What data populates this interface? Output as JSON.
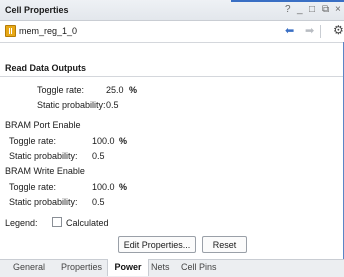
{
  "window": {
    "title": "Cell Properties",
    "controls": {
      "help": "?",
      "minimize": "_",
      "maximize": "□",
      "restore": "⧉",
      "close": "×"
    }
  },
  "toolbar": {
    "cell_name": "mem_reg_1_0",
    "back_glyph": "⬅",
    "forward_glyph": "➡",
    "settings_glyph": "⚙"
  },
  "read_outputs": {
    "header": "Read Data Outputs",
    "toggle_label": "Toggle rate:",
    "toggle_value": "25.0",
    "toggle_unit": "%",
    "static_label": "Static probability:",
    "static_value": "0.5"
  },
  "port_enable": {
    "title": "BRAM Port Enable",
    "toggle_label": "Toggle rate:",
    "toggle_value": "100.0",
    "toggle_unit": "%",
    "static_label": "Static probability:",
    "static_value": "0.5"
  },
  "write_enable": {
    "title": "BRAM Write Enable",
    "toggle_label": "Toggle rate:",
    "toggle_value": "100.0",
    "toggle_unit": "%",
    "static_label": "Static probability:",
    "static_value": "0.5"
  },
  "legend": {
    "label": "Legend:",
    "calculated": "Calculated"
  },
  "buttons": {
    "edit": "Edit Properties...",
    "reset": "Reset"
  },
  "tabs": [
    {
      "label": "General",
      "active": false
    },
    {
      "label": "Properties",
      "active": false
    },
    {
      "label": "Power",
      "active": true
    },
    {
      "label": "Nets",
      "active": false
    },
    {
      "label": "Cell Pins",
      "active": false
    }
  ],
  "colors": {
    "accent": "#3a6fc4",
    "cell_icon": "#e7a817"
  }
}
